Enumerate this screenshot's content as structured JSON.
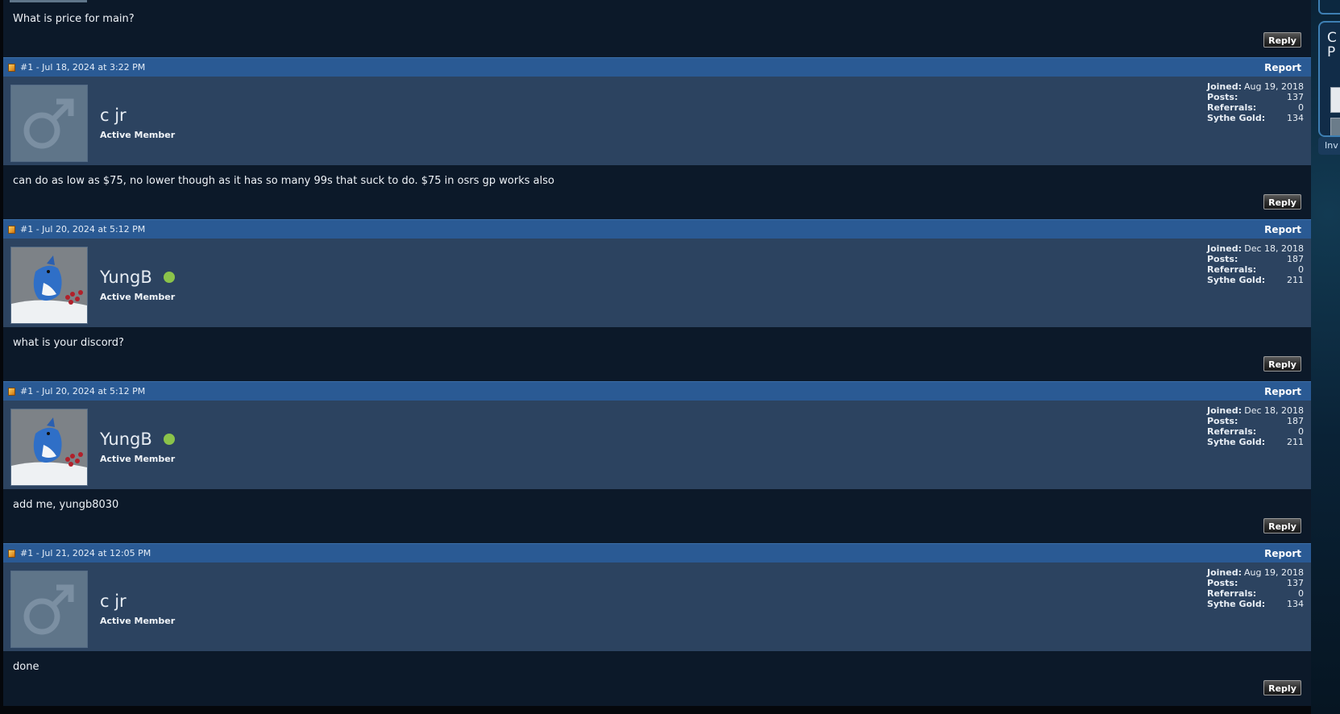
{
  "reply_label": "Reply",
  "report_label": "Report",
  "stat_labels": {
    "joined": "Joined:",
    "posts": "Posts:",
    "referrals": "Referrals:",
    "gold": "Sythe Gold:"
  },
  "first_body": {
    "text": "What is price for main?"
  },
  "posts": [
    {
      "meta": "#1 - Jul 18, 2024 at 3:22 PM",
      "username": "c jr",
      "rank": "Active Member",
      "joined": "Aug 19, 2018",
      "posts": "137",
      "referrals": "0",
      "gold": "134",
      "online": false,
      "avatar": "default-male-avatar",
      "text": "can do as low as $75, no lower though as it has so many 99s that suck to do. $75 in osrs gp works also"
    },
    {
      "meta": "#1 - Jul 20, 2024 at 5:12 PM",
      "username": "YungB",
      "rank": "Active Member",
      "joined": "Dec 18, 2018",
      "posts": "187",
      "referrals": "0",
      "gold": "211",
      "online": true,
      "avatar": "blue-jay-avatar",
      "text": "what is your discord?"
    },
    {
      "meta": "#1 - Jul 20, 2024 at 5:12 PM",
      "username": "YungB",
      "rank": "Active Member",
      "joined": "Dec 18, 2018",
      "posts": "187",
      "referrals": "0",
      "gold": "211",
      "online": true,
      "avatar": "blue-jay-avatar",
      "text": "add me, yungb8030"
    },
    {
      "meta": "#1 - Jul 21, 2024 at 12:05 PM",
      "username": "c jr",
      "rank": "Active Member",
      "joined": "Aug 19, 2018",
      "posts": "137",
      "referrals": "0",
      "gold": "134",
      "online": false,
      "avatar": "default-male-avatar",
      "text": "done"
    }
  ],
  "sidebar": {
    "box_title": "C\nP",
    "pill_label": "Inv"
  },
  "colors": {
    "header_bar": "#2a5a94",
    "user_bar": "#2c4360",
    "post_body": "#0c1929",
    "online": "#8bc34a"
  }
}
